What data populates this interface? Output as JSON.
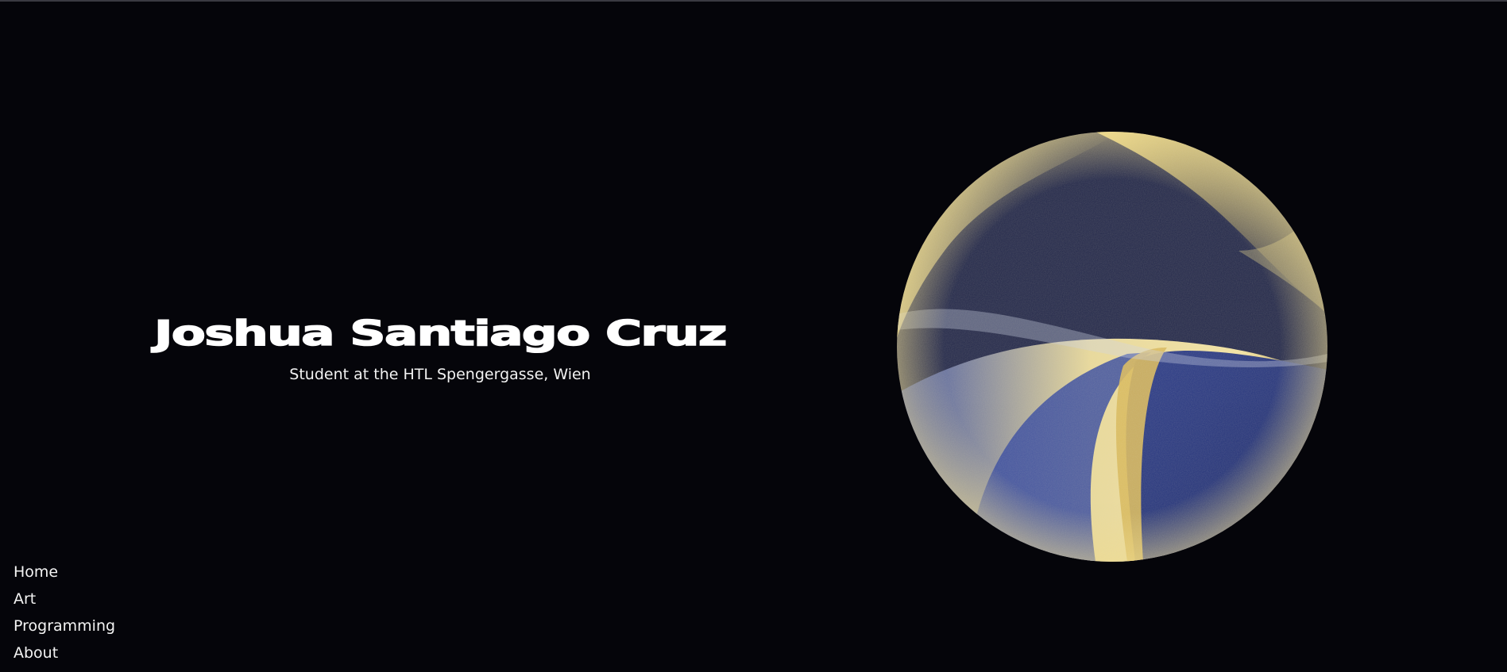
{
  "hero": {
    "title": "Joshua Santiago Cruz",
    "subtitle": "Student at the HTL Spengergasse, Wien"
  },
  "artwork": {
    "shape": "circle",
    "colors": {
      "background": "#05050a",
      "navy": "#23284a",
      "deep_blue": "#263a86",
      "gold": "#f0dc8c"
    }
  },
  "nav": {
    "items": [
      {
        "label": "Home"
      },
      {
        "label": "Art"
      },
      {
        "label": "Programming"
      },
      {
        "label": "About"
      }
    ]
  }
}
